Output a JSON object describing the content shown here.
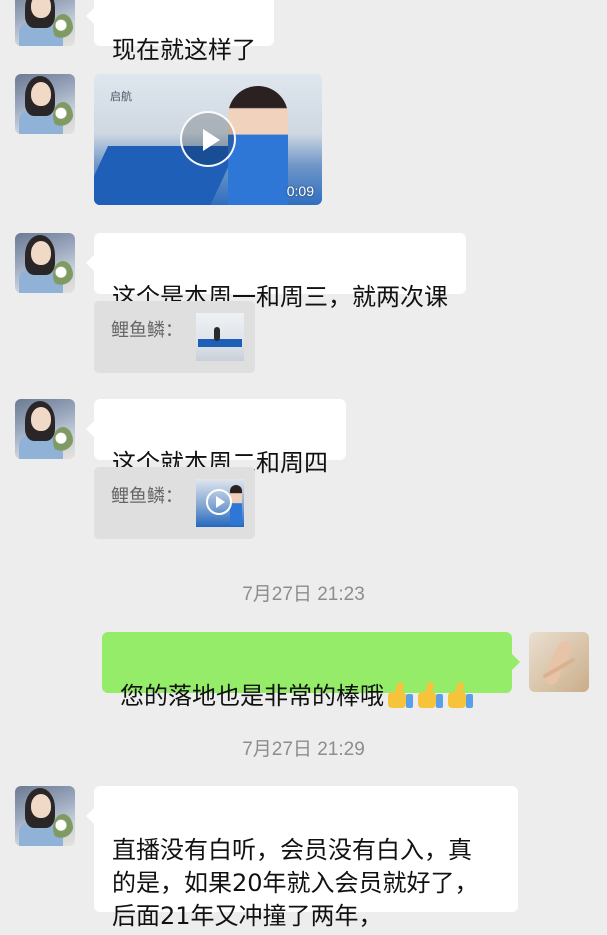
{
  "messages": {
    "msg1": "现在就这样了",
    "video_duration": "0:09",
    "video_logo": "启航",
    "msg2": "这个是本周一和周三，就两次课",
    "quote1_sender": "鲤鱼鳞：",
    "msg3": "这个就本周二和周四",
    "quote2_sender": "鲤鱼鳞：",
    "timestamp1": "7月27日 21:23",
    "msg4": "您的落地也是非常的棒哦",
    "timestamp2": "7月27日 21:29",
    "msg5": "直播没有白听，会员没有白入，真\n的是，如果20年就入会员就好了，\n后面21年又冲撞了两年，"
  },
  "colors": {
    "background": "#ededed",
    "bubble_incoming": "#ffffff",
    "bubble_outgoing": "#95ec69",
    "quote_background": "#dfdfdf",
    "timestamp_text": "#8d8d8d"
  },
  "icons": {
    "video_play": "play-icon",
    "emoji": "thumbs-up-icon"
  }
}
